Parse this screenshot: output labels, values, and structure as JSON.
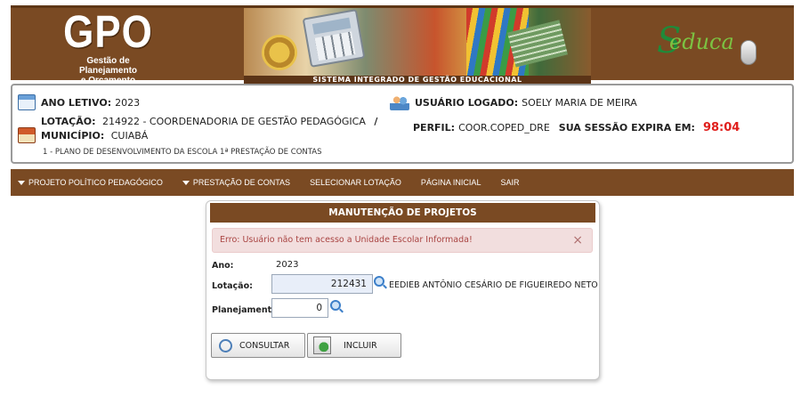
{
  "header": {
    "logo_main": "GPO",
    "logo_sub1": "Gestão de Planejamento",
    "logo_sub2": "e Orçamento",
    "system_name": "SISTEMA INTEGRADO DE GESTÃO EDUCACIONAL",
    "logo_right": "Seduca"
  },
  "info": {
    "ano_label": "ANO LETIVO:",
    "ano_value": "2023",
    "lotacao_label": "LOTAÇÃO:",
    "lotacao_value": "214922 - COORDENADORIA DE GESTÃO PEDAGÓGICA",
    "lotacao_sep": "/",
    "municipio_label": "MUNICÍPIO:",
    "municipio_value": "CUIABÁ",
    "plano_line": "1 - PLANO DE DESENVOLVIMENTO DA ESCOLA  1ª PRESTAÇÃO DE CONTAS",
    "usuario_label": "USUÁRIO LOGADO:",
    "usuario_value": "SOELY MARIA DE MEIRA",
    "perfil_label": "PERFIL:",
    "perfil_value": "COOR.COPED_DRE",
    "sessao_label": "SUA SESSÃO EXPIRA EM:",
    "sessao_value": "98:04"
  },
  "menu": {
    "items": [
      {
        "label": "PROJETO POLÍTICO PEDAGÓGICO",
        "dropdown": true
      },
      {
        "label": "PRESTAÇÃO DE CONTAS",
        "dropdown": true
      },
      {
        "label": "SELECIONAR LOTAÇÃO",
        "dropdown": false
      },
      {
        "label": "PÁGINA INICIAL",
        "dropdown": false
      },
      {
        "label": "SAIR",
        "dropdown": false
      }
    ]
  },
  "panel": {
    "title": "MANUTENÇÃO DE PROJETOS",
    "error": "Erro: Usuário não tem acesso a Unidade Escolar Informada!",
    "close": "×",
    "ano_label": "Ano:",
    "ano_value": "2023",
    "lotacao_label": "Lotação:",
    "lotacao_value": "212431",
    "lotacao_name": "EEDIEB ANTÔNIO CESÁRIO DE FIGUEIREDO NETO",
    "planejamento_label": "Planejamento:",
    "planejamento_value": "0",
    "consultar_label": "CONSULTAR",
    "incluir_label": "INCLUIR"
  },
  "colors": {
    "brand_brown": "#7a4a23",
    "expire_red": "#e0201d",
    "alert_bg": "#f2dede",
    "alert_text": "#a94442"
  }
}
